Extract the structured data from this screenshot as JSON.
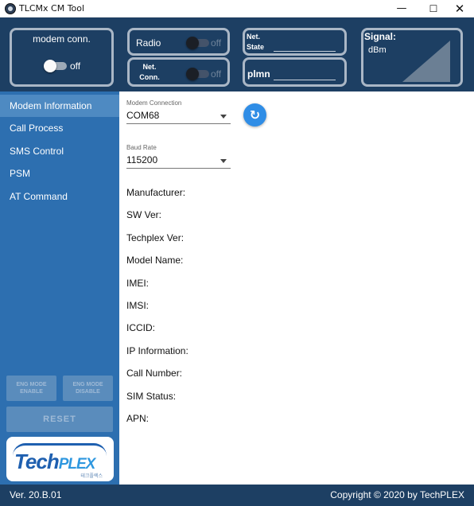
{
  "window": {
    "title": "TLCMx CM Tool",
    "controls": {
      "minimize": "—",
      "maximize": "☐",
      "close": "✕"
    }
  },
  "header": {
    "modem_conn": {
      "title": "modem conn.",
      "state": "off"
    },
    "radio": {
      "label": "Radio",
      "state": "off"
    },
    "net_conn": {
      "label_line1": "Net.",
      "label_line2": "Conn.",
      "state": "off"
    },
    "net_state": {
      "label_line1": "Net.",
      "label_line2": "State",
      "value": ""
    },
    "plmn": {
      "label": "plmn",
      "value": ""
    },
    "signal": {
      "label": "Signal:",
      "unit": "dBm",
      "value": ""
    }
  },
  "sidebar": {
    "items": [
      {
        "label": "Modem Information",
        "active": true
      },
      {
        "label": "Call Process",
        "active": false
      },
      {
        "label": "SMS Control",
        "active": false
      },
      {
        "label": "PSM",
        "active": false
      },
      {
        "label": "AT Command",
        "active": false
      }
    ],
    "eng_enable": {
      "line1": "ENG MODE",
      "line2": "ENABLE"
    },
    "eng_disable": {
      "line1": "ENG MODE",
      "line2": "DISABLE"
    },
    "reset": "RESET",
    "logo": {
      "main": "Tech",
      "accent": "PLEX",
      "sub": "테크플렉스"
    }
  },
  "main": {
    "modem_connection": {
      "label": "Modem Connection",
      "value": "COM68"
    },
    "baud_rate": {
      "label": "Baud Rate",
      "value": "115200"
    },
    "fields": [
      "Manufacturer:",
      "SW Ver:",
      "Techplex Ver:",
      "Model Name:",
      "IMEI:",
      "IMSI:",
      "ICCID:",
      "IP Information:",
      "Call Number:",
      "SIM Status:",
      "APN:"
    ]
  },
  "footer": {
    "version": "Ver. 20.B.01",
    "copyright": "Copyright © 2020 by TechPLEX"
  },
  "colors": {
    "header_bg": "#1d3f63",
    "sidebar_bg": "#2d6fb0",
    "sidebar_active": "#4e8ac2",
    "accent_button": "#2f8de6"
  }
}
